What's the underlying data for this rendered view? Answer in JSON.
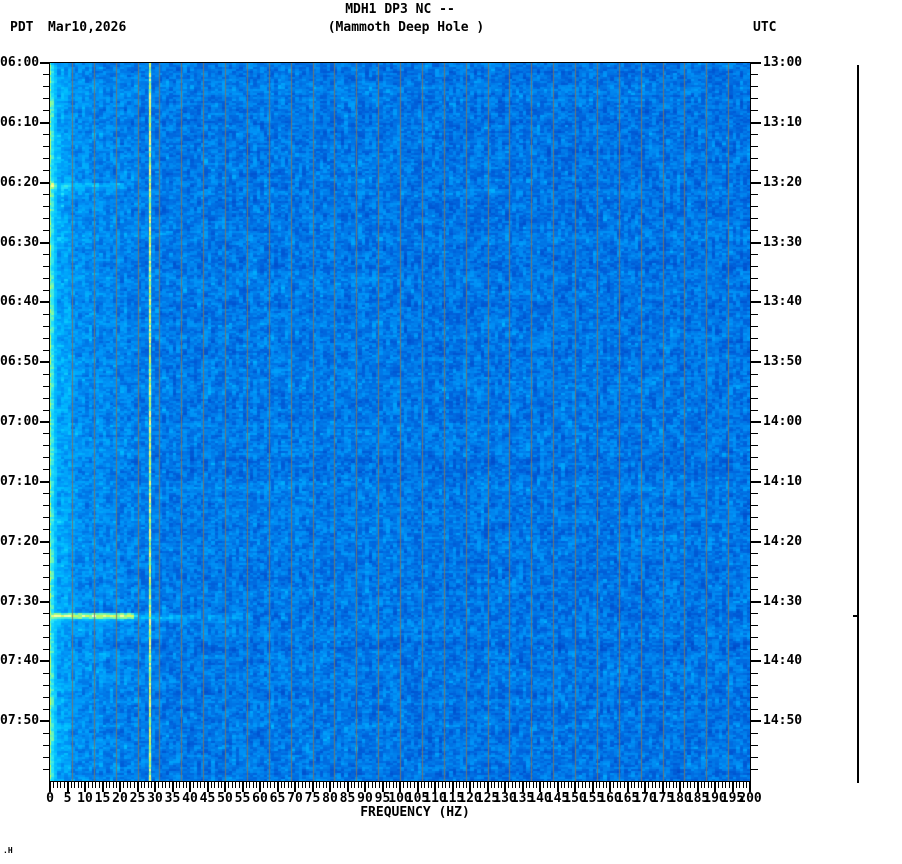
{
  "header": {
    "left_timezone": "PDT",
    "date": "Mar10,2026",
    "title": "MDH1 DP3 NC --",
    "subtitle": "(Mammoth Deep Hole )",
    "right_timezone": "UTC"
  },
  "chart_data": {
    "type": "heatmap",
    "subtype": "seismic spectrogram",
    "title": "MDH1 DP3 NC --",
    "subtitle": "(Mammoth Deep Hole )",
    "station_name": "Mammoth Deep Hole",
    "x": {
      "label": "FREQUENCY (HZ)",
      "range_hz": [
        0,
        200
      ],
      "major_tick_hz": 5,
      "minor_tick_hz": 1,
      "tick_labels": [
        "0",
        "5",
        "10",
        "15",
        "20",
        "25",
        "30",
        "35",
        "40",
        "45",
        "50",
        "55",
        "60",
        "65",
        "70",
        "75",
        "80",
        "85",
        "90",
        "95",
        "100",
        "105",
        "110",
        "115",
        "120",
        "125",
        "130",
        "135",
        "140",
        "145",
        "150",
        "155",
        "160",
        "165",
        "170",
        "175",
        "180",
        "185",
        "190",
        "195",
        "200"
      ]
    },
    "y_left": {
      "timezone": "PDT",
      "start": "06:00",
      "end": "08:00",
      "major_tick_min": 10,
      "minor_tick_min": 2,
      "tick_labels": [
        "06:00",
        "06:10",
        "06:20",
        "06:30",
        "06:40",
        "06:50",
        "07:00",
        "07:10",
        "07:20",
        "07:30",
        "07:40",
        "07:50"
      ]
    },
    "y_right": {
      "timezone": "UTC",
      "start": "13:00",
      "end": "15:00",
      "tick_labels": [
        "13:00",
        "13:10",
        "13:20",
        "13:30",
        "13:40",
        "13:50",
        "14:00",
        "14:10",
        "14:20",
        "14:30",
        "14:40",
        "14:50"
      ]
    },
    "palette": {
      "background_low": "#0044bb",
      "background_mid": "#0aa0f5",
      "background_high": "#00e8ff",
      "strong": "#aaee44",
      "peak": "#ffffaa",
      "gridline": "#7d7664",
      "axis": "#000000"
    },
    "features": [
      {
        "kind": "persistent_narrowband_line",
        "freq_hz": 28.3,
        "time_span": "entire record",
        "appearance": "thin yellow-green vertical spectral line"
      },
      {
        "kind": "low_frequency_band",
        "freq_range_hz": [
          0,
          5
        ],
        "time_span": "entire record",
        "appearance": "bright cyan-green energy at lowest frequencies"
      },
      {
        "kind": "transient_event",
        "time_pdt": "07:32",
        "time_utc": "14:32",
        "freq_range_hz": [
          0,
          57
        ],
        "strongest_freq_range_hz": [
          0,
          23
        ],
        "appearance": "horizontal yellow-white streak fading above ~25 Hz"
      },
      {
        "kind": "weak_transient_band",
        "time_pdt": "06:20",
        "time_utc": "13:20",
        "freq_range_hz": [
          0,
          20
        ],
        "appearance": "faint brighter cyan horizontal band"
      }
    ],
    "amplitude_bar": {
      "position": "right margin",
      "event_mark_time_pdt": "07:32"
    }
  },
  "decorations": {
    "artifact_text": ".H"
  }
}
